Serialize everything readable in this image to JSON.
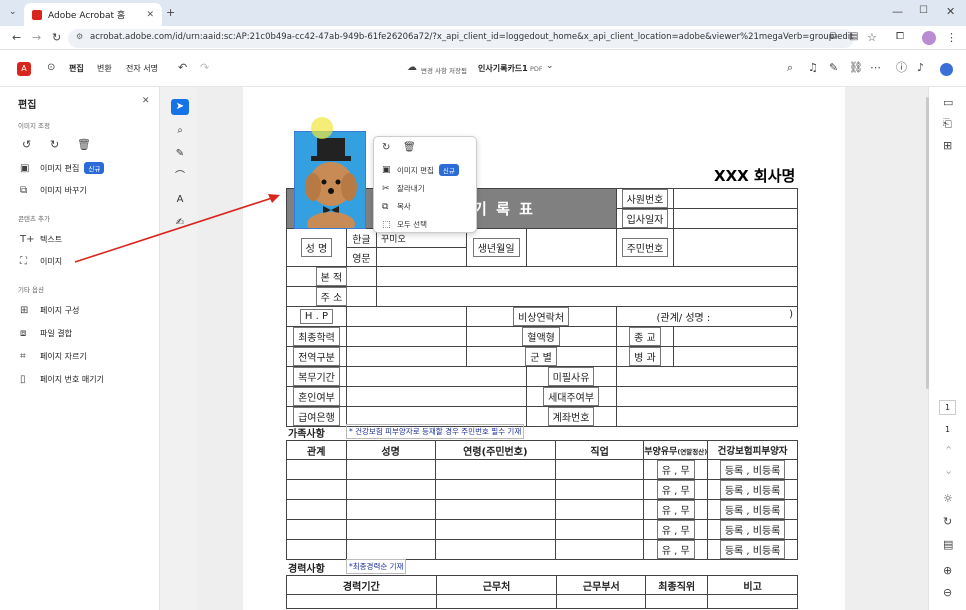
{
  "browser": {
    "tab_title": "Adobe Acrobat 홈",
    "url": "acrobat.adobe.com/id/urn:aaid:sc:AP:21c0b49a-cc42-47ab-949b-61fe26206a72/?x_api_client_id=loggedout_home&x_api_client_location=adobe&viewer%21megaVerb=group-edit&filetype=application%2"
  },
  "app": {
    "tabs": [
      "편집",
      "변환",
      "전자 서명"
    ],
    "save_status": "변경 사항 저장됨",
    "doc_name": "인사기록카드1",
    "doc_type": "PDF"
  },
  "panel": {
    "title": "편집",
    "section_image": "이미지 조정",
    "edit_image": "이미지 편집",
    "new_badge": "신규",
    "replace_image": "이미지 바꾸기",
    "section_add": "콘텐츠 추가",
    "text": "텍스트",
    "image": "이미지",
    "section_other": "기타 옵션",
    "organize": "페이지 구성",
    "combine": "파일 결합",
    "crop": "페이지 자르기",
    "number": "페이지 번호 매기기"
  },
  "context_menu": {
    "edit_image": "이미지 편집",
    "new_badge": "신규",
    "crop": "잘라내기",
    "copy": "복사",
    "select_all": "모두 선택"
  },
  "page_nav": {
    "current": "1",
    "total": "1"
  },
  "doc": {
    "company": "XXX 회사명",
    "title": "인 사 기 록 표",
    "emp_no": "사원번호",
    "join_date": "입사일자",
    "name": "성 명",
    "hangul": "한글",
    "english": "영문",
    "hangul_value": "꾸미오",
    "birth": "생년월일",
    "resident_no": "주민번호",
    "origin": "본 적",
    "address": "주 소",
    "hp": "H . P",
    "emergency": "비상연락처",
    "relation": "(관계/ 성명 :",
    "relation_close": ")",
    "education": "최종학력",
    "blood": "혈액형",
    "religion": "종 교",
    "category": "전역구분",
    "military": "군 별",
    "disease": "병 과",
    "service": "복무기간",
    "exempt": "미필사유",
    "marriage": "혼인여부",
    "household": "세대주여부",
    "bank": "급여은행",
    "account": "계좌번호",
    "family_title": "가족사항",
    "family_note": "* 건강보험 피부양자로 등재할 경우 주민번호 필수 기재",
    "family_headers": [
      "관계",
      "성명",
      "연령(주민번호)",
      "직업",
      "부양유무",
      "건강보험피부양자"
    ],
    "support_note": "(연말정산)",
    "yes_no": "유 , 무",
    "reg_status": "등록 , 비등록",
    "career_title": "경력사항",
    "career_note": "*최종경력순 기재",
    "career_headers": [
      "경력기간",
      "근무처",
      "근무부서",
      "최종직위",
      "비고"
    ]
  }
}
